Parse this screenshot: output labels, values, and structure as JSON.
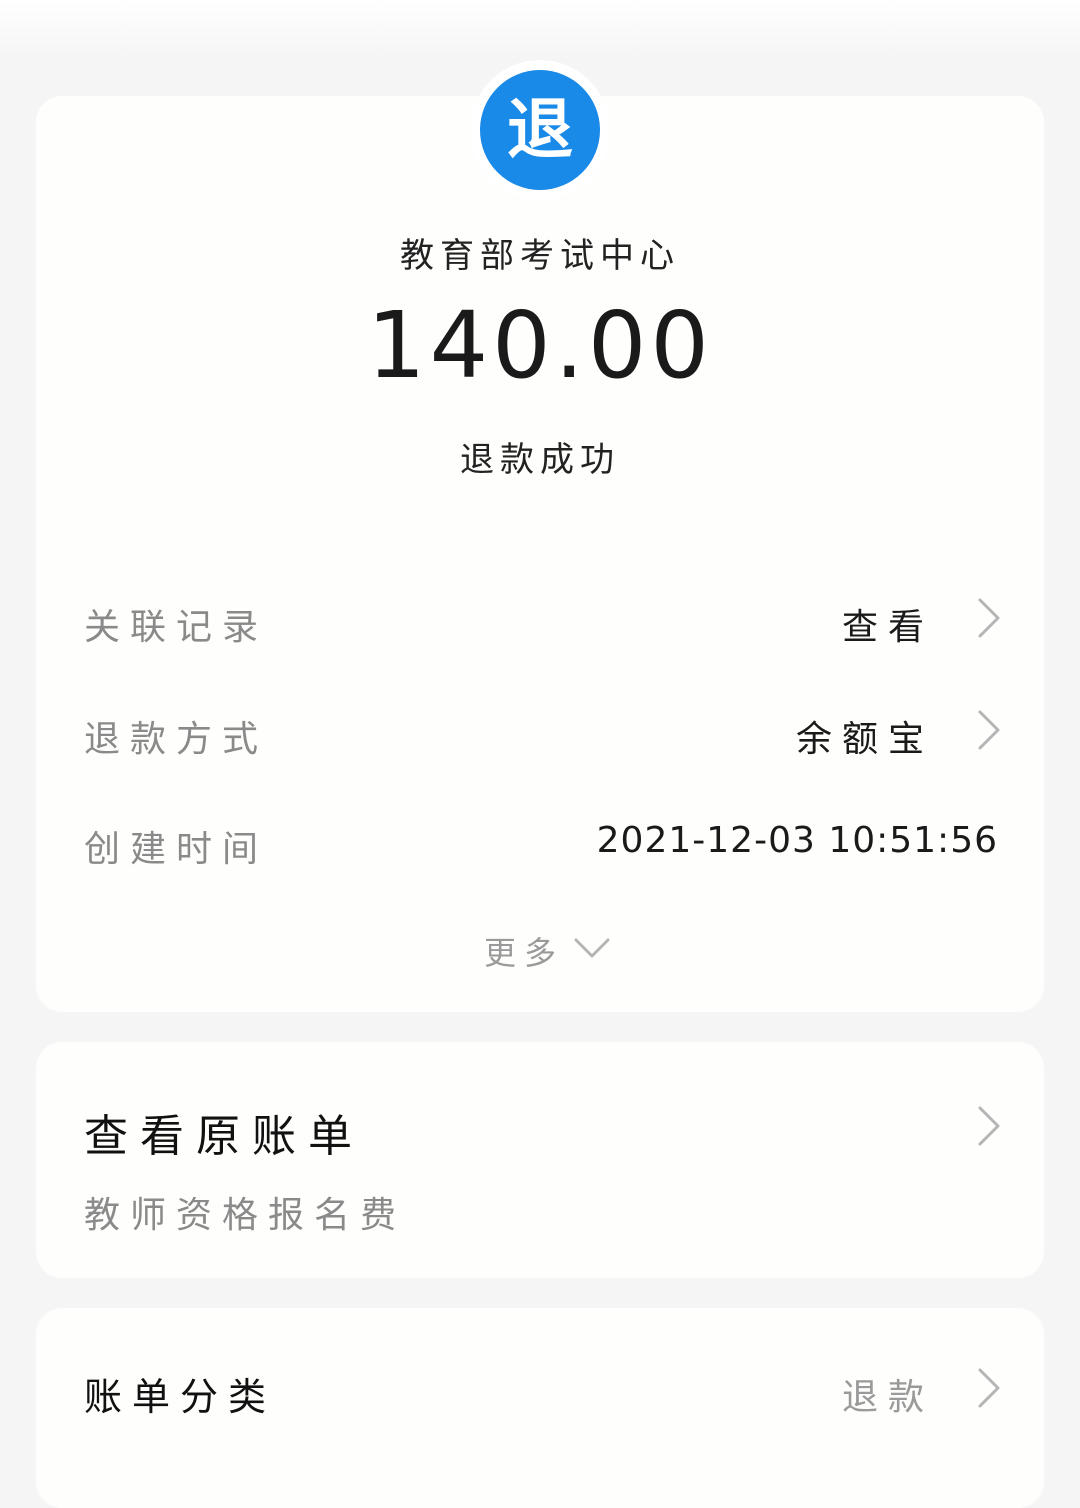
{
  "header": {
    "avatar_char": "退",
    "merchant": "教育部考试中心",
    "amount": "140.00",
    "status": "退款成功"
  },
  "details": {
    "related_label": "关联记录",
    "related_value": "查看",
    "method_label": "退款方式",
    "method_value": "余额宝",
    "time_label": "创建时间",
    "time_value": "2021-12-03 10:51:56",
    "more_label": "更多"
  },
  "bill": {
    "title": "查看原账单",
    "subtitle": "教师资格报名费"
  },
  "category": {
    "label": "账单分类",
    "value": "退款"
  },
  "colors": {
    "accent": "#1a8ae8",
    "background": "#f5f5f5",
    "card": "#fefefc"
  },
  "icons": {
    "row_arrow": "chevron-right-icon",
    "more_arrow": "chevron-down-icon"
  }
}
